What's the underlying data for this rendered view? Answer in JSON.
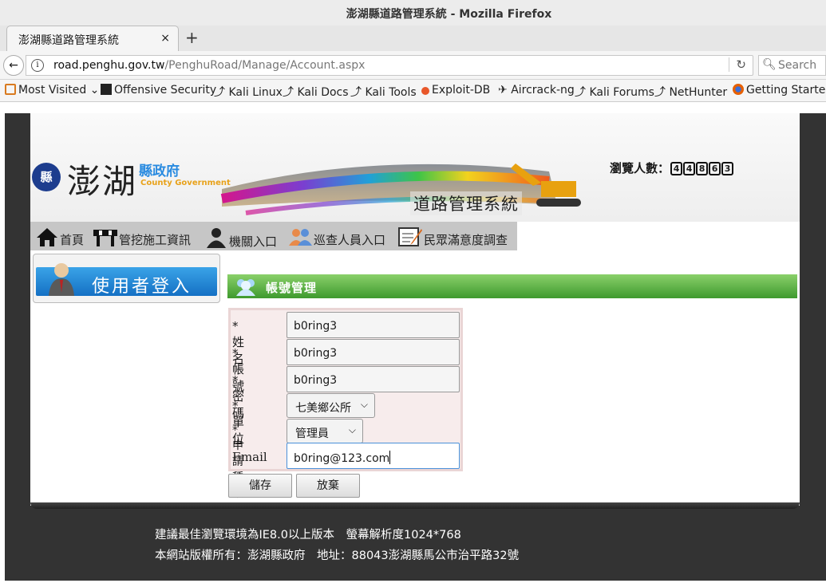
{
  "window": {
    "title": "澎湖縣道路管理系統 - Mozilla Firefox"
  },
  "tab": {
    "title": "澎湖縣道路管理系統",
    "close": "×",
    "new": "+"
  },
  "nav": {
    "url_domain": "road.penghu.gov.tw",
    "url_path": "/PenghuRoad/Manage/Account.aspx",
    "search_placeholder": "Search"
  },
  "bookmarks": [
    {
      "label": "Most Visited",
      "icon": "folder-icon",
      "color": "#d97a1f"
    },
    {
      "label": "Offensive Security",
      "icon": "offsec-icon",
      "color": "#222"
    },
    {
      "label": "Kali Linux",
      "icon": "kali-dragon-icon",
      "color": "#222"
    },
    {
      "label": "Kali Docs",
      "icon": "kali-dragon-icon",
      "color": "#222"
    },
    {
      "label": "Kali Tools",
      "icon": "kali-dragon-icon",
      "color": "#222"
    },
    {
      "label": "Exploit-DB",
      "icon": "exploitdb-icon",
      "color": "#e8572a"
    },
    {
      "label": "Aircrack-ng",
      "icon": "aircrack-icon",
      "color": "#345"
    },
    {
      "label": "Kali Forums",
      "icon": "kali-dragon-icon",
      "color": "#222"
    },
    {
      "label": "NetHunter",
      "icon": "kali-dragon-icon",
      "color": "#222"
    },
    {
      "label": "Getting Started",
      "icon": "firefox-icon",
      "color": "#e66000"
    }
  ],
  "site": {
    "brand": "澎湖",
    "gov": "縣政府",
    "gov_en": "County Government",
    "system_name": "道路管理系統",
    "visitor_label": "瀏覽人數：",
    "visitor_digits": [
      "4",
      "4",
      "8",
      "6",
      "3"
    ],
    "menu": [
      {
        "label": "首頁",
        "icon": "home-icon"
      },
      {
        "label": "管挖施工資訊",
        "icon": "construction-barrier-icon"
      },
      {
        "label": "機關入口",
        "icon": "officer-icon"
      },
      {
        "label": "巡查人員入口",
        "icon": "people-icon"
      },
      {
        "label": "民眾滿意度調查",
        "icon": "survey-icon"
      }
    ],
    "login_label": "使用者登入",
    "section_title": "帳號管理"
  },
  "form": {
    "name": {
      "label": "*姓名",
      "value": "b0ring3"
    },
    "account": {
      "label": "*帳號",
      "value": "b0ring3"
    },
    "password": {
      "label": "*密碼",
      "value": "b0ring3"
    },
    "unit": {
      "label": "*單位",
      "value": "七美鄉公所"
    },
    "apply_type": {
      "label": "*申請種類",
      "value": "管理員"
    },
    "email": {
      "label": "Email",
      "value": "b0ring@123.com"
    },
    "save": "儲存",
    "cancel": "放棄"
  },
  "footer": {
    "line1": "建議最佳瀏覽環境為IE8.0以上版本　螢幕解析度1024*768",
    "line2": "本網站版權所有：澎湖縣政府　地址：88043澎湖縣馬公市治平路32號"
  }
}
